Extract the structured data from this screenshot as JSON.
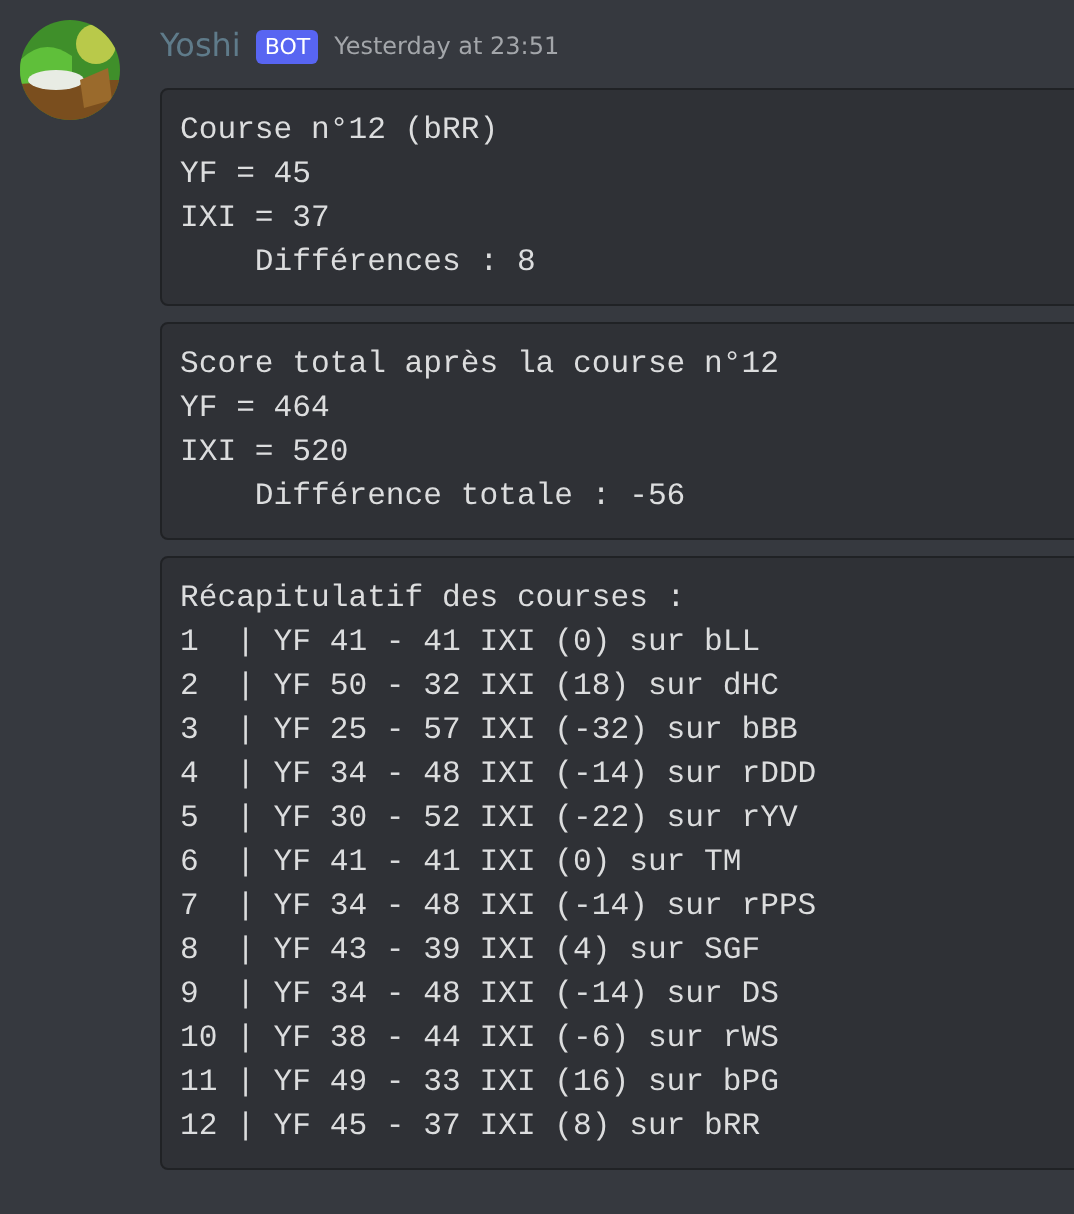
{
  "message": {
    "author": "Yoshi",
    "tag": "BOT",
    "timestamp": "Yesterday at 23:51",
    "code_blocks": [
      {
        "lines": [
          "Course n°12 (bRR)",
          "YF = 45",
          "IXI = 37",
          "    Différences : 8"
        ]
      },
      {
        "lines": [
          "Score total après la course n°12",
          "YF = 464",
          "IXI = 520",
          "    Différence totale : -56"
        ]
      },
      {
        "lines": [
          "Récapitulatif des courses :",
          "1  | YF 41 - 41 IXI (0) sur bLL",
          "2  | YF 50 - 32 IXI (18) sur dHC",
          "3  | YF 25 - 57 IXI (-32) sur bBB",
          "4  | YF 34 - 48 IXI (-14) sur rDDD",
          "5  | YF 30 - 52 IXI (-22) sur rYV",
          "6  | YF 41 - 41 IXI (0) sur TM",
          "7  | YF 34 - 48 IXI (-14) sur rPPS",
          "8  | YF 43 - 39 IXI (4) sur SGF",
          "9  | YF 34 - 48 IXI (-14) sur DS",
          "10 | YF 38 - 44 IXI (-6) sur rWS",
          "11 | YF 49 - 33 IXI (16) sur bPG",
          "12 | YF 45 - 37 IXI (8) sur bRR"
        ]
      }
    ]
  }
}
